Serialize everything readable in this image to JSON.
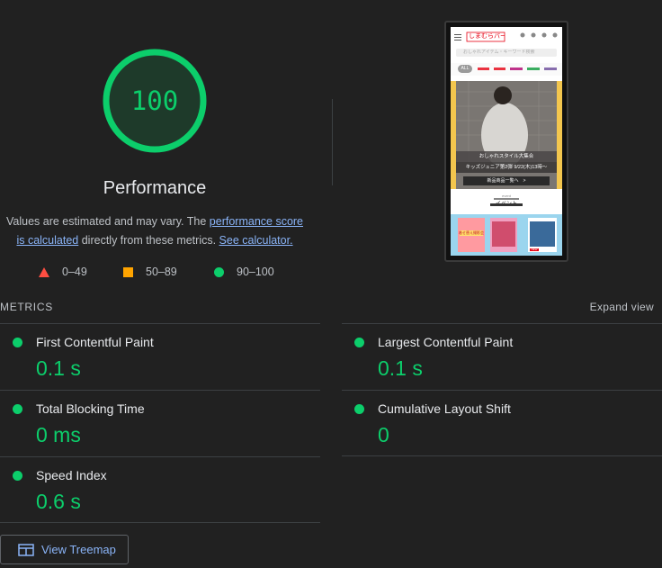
{
  "gauge": {
    "score": "100",
    "score_fraction": 1.0,
    "title": "Performance"
  },
  "description": {
    "prefix": "Values are estimated and may vary. The ",
    "link1": "performance score",
    "link1b": "is calculated",
    "middle": " directly from these metrics. ",
    "link2": "See calculator."
  },
  "legend": [
    {
      "icon": "triangle-icon",
      "range": "0–49",
      "color": "#ff4e42"
    },
    {
      "icon": "square-icon",
      "range": "50–89",
      "color": "#ffa400"
    },
    {
      "icon": "circle-icon",
      "range": "90–100",
      "color": "#0cce6b"
    }
  ],
  "screenshot": {
    "logo": "しまむらパーク",
    "search_placeholder": "おしゃれアイテム・キーワード検索",
    "tabs": [
      "ALL",
      "しまむら",
      "アベイル",
      "バースデイ",
      "シャンブル",
      "ディバロ"
    ],
    "banner_line1": "おしゃれスタイル大集合",
    "banner_line2": "キッズジュニア第2弾 9/22(木)13時〜",
    "banner_button": "新品商品一覧へ　>",
    "event_en": "event",
    "event_ja": "イベント",
    "poster_text": "着せ替え撮影会",
    "tile_badge": "NEW"
  },
  "metrics_header": {
    "label": "METRICS",
    "expand": "Expand view"
  },
  "metrics": [
    {
      "title": "First Contentful Paint",
      "value": "0.1 s"
    },
    {
      "title": "Largest Contentful Paint",
      "value": "0.1 s"
    },
    {
      "title": "Total Blocking Time",
      "value": "0 ms"
    },
    {
      "title": "Cumulative Layout Shift",
      "value": "0"
    },
    {
      "title": "Speed Index",
      "value": "0.6 s"
    }
  ],
  "treemap_button": {
    "label": "View Treemap",
    "icon": "treemap-icon"
  },
  "colors": {
    "pass": "#0cce6b",
    "average": "#ffa400",
    "fail": "#ff4e42",
    "link": "#8ab4f8",
    "background": "#212121"
  }
}
